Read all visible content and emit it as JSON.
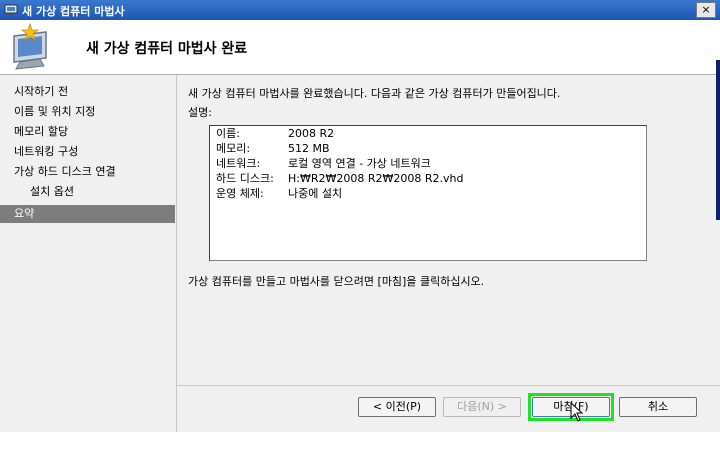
{
  "window": {
    "title": "새 가상 컴퓨터 마법사",
    "close_label": "×"
  },
  "header": {
    "title": "새 가상 컴퓨터 마법사 완료"
  },
  "nav": {
    "items": [
      {
        "label": "시작하기 전",
        "sub": false,
        "active": false
      },
      {
        "label": "이름 및 위치 지정",
        "sub": false,
        "active": false
      },
      {
        "label": "메모리 할당",
        "sub": false,
        "active": false
      },
      {
        "label": "네트워킹 구성",
        "sub": false,
        "active": false
      },
      {
        "label": "가상 하드 디스크 연결",
        "sub": false,
        "active": false
      },
      {
        "label": "설치 옵션",
        "sub": true,
        "active": false
      },
      {
        "label": "요약",
        "sub": false,
        "active": true
      }
    ]
  },
  "main": {
    "intro": "새 가상 컴퓨터 마법사를 완료했습니다. 다음과 같은 가상 컴퓨터가 만들어집니다.",
    "description_label": "설명:",
    "summary": [
      {
        "key": "이름:",
        "value": "2008 R2"
      },
      {
        "key": "메모리:",
        "value": "512 MB"
      },
      {
        "key": "네트워크:",
        "value": "로컬 영역 연결 - 가상 네트워크"
      },
      {
        "key": "하드 디스크:",
        "value": "H:₩R2₩2008 R2₩2008 R2.vhd"
      },
      {
        "key": "운영 체제:",
        "value": "나중에 설치"
      }
    ],
    "footer": "가상 컴퓨터를 만들고 마법사를 닫으려면 [마침]을 클릭하십시오."
  },
  "buttons": {
    "previous": "< 이전(P)",
    "next": "다음(N) >",
    "finish": "마침(F)",
    "cancel": "취소"
  },
  "colors": {
    "titlebar": "#1d55b4",
    "active_nav": "#7d7d7d",
    "highlight": "#22e022"
  }
}
